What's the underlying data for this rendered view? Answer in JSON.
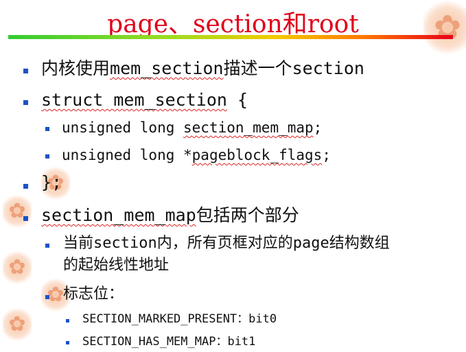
{
  "slide": {
    "title": "page、section和root",
    "bullets": {
      "b1": {
        "prefix": "内核使用",
        "term": "mem_section",
        "suffix": "描述一个section"
      },
      "b2": {
        "text1": "struct ",
        "term": "mem_section",
        "text2": " {"
      },
      "b2a": {
        "prefix": "unsigned long ",
        "term": "section_mem_map",
        "suffix": ";"
      },
      "b2b": {
        "prefix": "unsigned long *",
        "term": "pageblock_flags",
        "suffix": ";"
      },
      "b3": "};",
      "b4": {
        "term": "section_mem_map",
        "suffix": "包括两个部分"
      },
      "b4a_line1": "当前section内，所有页框对应的page结构数组",
      "b4a_line2": "的起始线性地址",
      "b4b": "标志位：",
      "b4b1": "SECTION_MARKED_PRESENT：bit0",
      "b4b2": "SECTION_HAS_MEM_MAP：bit1"
    }
  }
}
